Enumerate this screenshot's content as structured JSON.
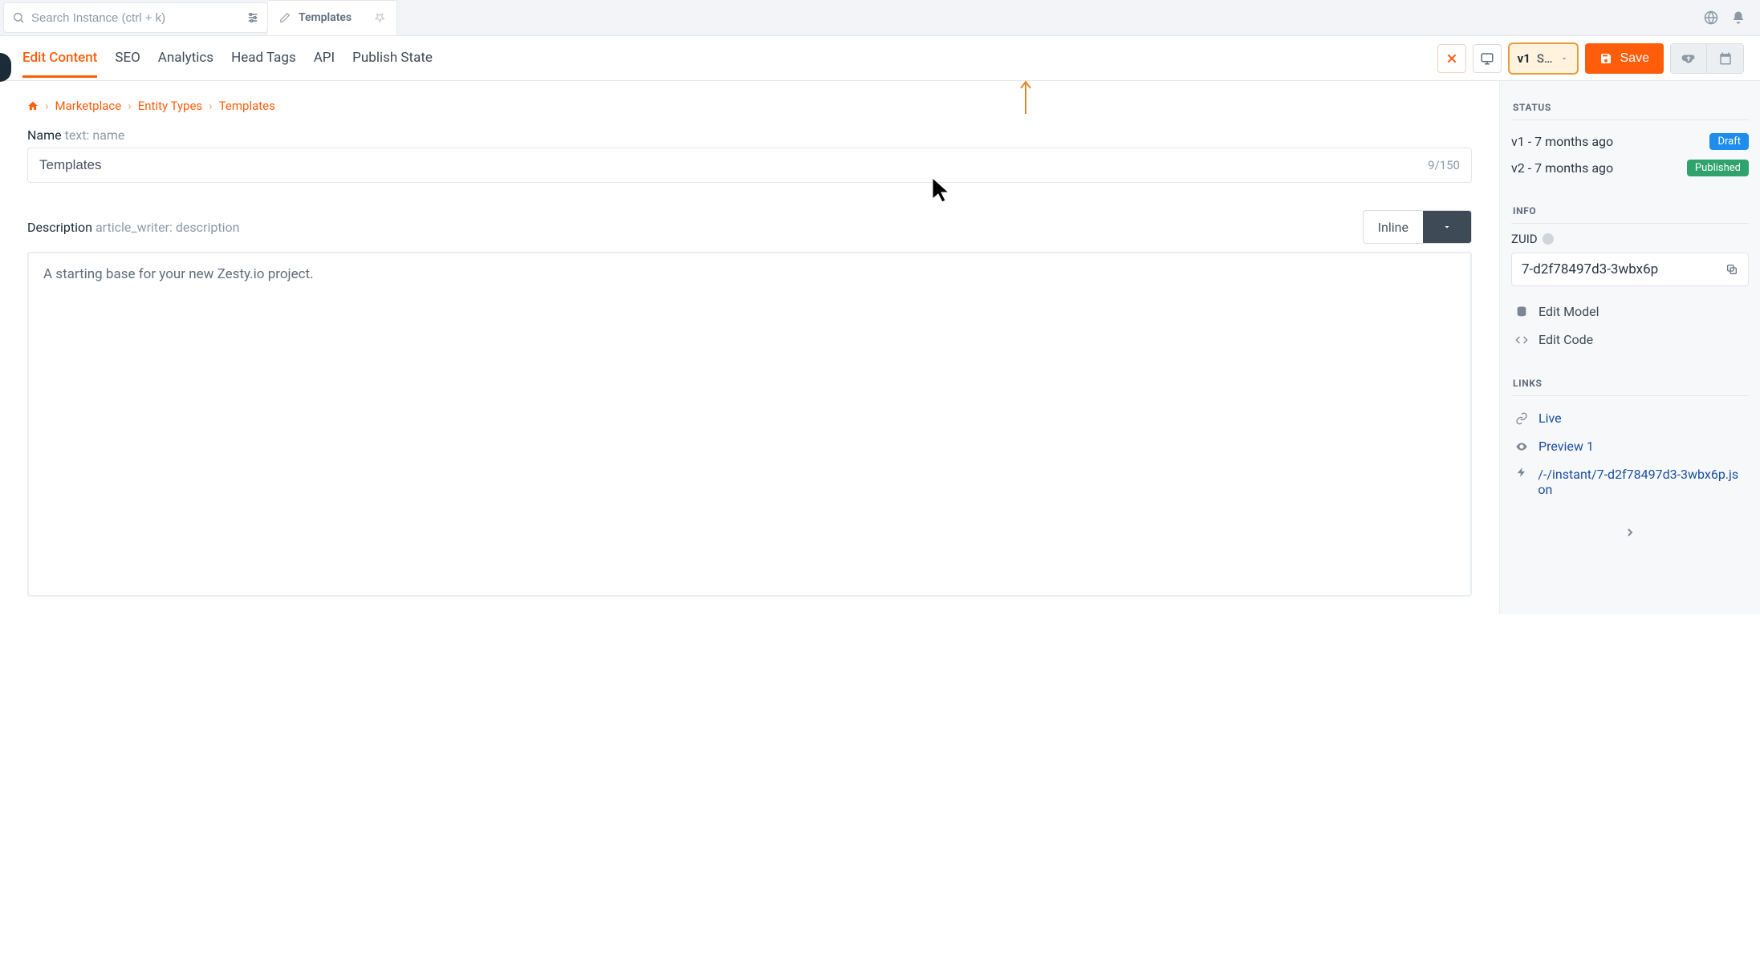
{
  "search": {
    "placeholder": "Search Instance (ctrl + k)"
  },
  "open_tab": {
    "label": "Templates"
  },
  "nav": {
    "tabs": [
      "Edit Content",
      "SEO",
      "Analytics",
      "Head Tags",
      "API",
      "Publish State"
    ],
    "active": 0
  },
  "version_selector": {
    "version": "v1",
    "state_abbrev": "S…"
  },
  "save_label": "Save",
  "breadcrumbs": [
    "Marketplace",
    "Entity Types",
    "Templates"
  ],
  "fields": {
    "name": {
      "label": "Name",
      "sub": "text: name",
      "value": "Templates",
      "counter": "9/150"
    },
    "description": {
      "label": "Description",
      "sub": "article_writer: description",
      "mode_label": "Inline",
      "content": "A starting base for your new Zesty.io project."
    }
  },
  "sidebar": {
    "status": {
      "heading": "STATUS",
      "versions": [
        {
          "label": "v1 - 7 months ago",
          "badge": "Draft",
          "badge_kind": "draft"
        },
        {
          "label": "v2 - 7 months ago",
          "badge": "Published",
          "badge_kind": "published"
        }
      ]
    },
    "info": {
      "heading": "INFO",
      "zuid_label": "ZUID",
      "zuid_value": "7-d2f78497d3-3wbx6p",
      "edit_model_label": "Edit Model",
      "edit_code_label": "Edit Code"
    },
    "links": {
      "heading": "LINKS",
      "live_label": "Live",
      "preview_label": "Preview 1",
      "instant_label": "/-/instant/7-d2f78497d3-3wbx6p.json"
    }
  }
}
